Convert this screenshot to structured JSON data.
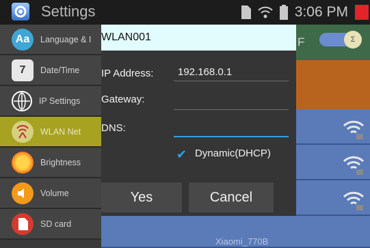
{
  "app": {
    "title": "Settings"
  },
  "status": {
    "time": "3:06 PM"
  },
  "sidebar": {
    "items": [
      {
        "label": "Language & I",
        "icon": "language-icon",
        "selected": false
      },
      {
        "label": "Date/Time",
        "icon": "calendar-icon",
        "selected": false
      },
      {
        "label": "IP Settings",
        "icon": "globe-icon",
        "selected": false
      },
      {
        "label": "WLAN Net",
        "icon": "wlan-icon",
        "selected": true
      },
      {
        "label": "Brightness",
        "icon": "brightness-icon",
        "selected": false
      },
      {
        "label": "Volume",
        "icon": "volume-icon",
        "selected": false
      },
      {
        "label": "SD card",
        "icon": "sd-card-icon",
        "selected": false
      }
    ]
  },
  "content": {
    "header_letter": "F",
    "toggle_knob": "Σ",
    "network_partial": "Xiaomi_770B"
  },
  "dialog": {
    "title": "WLAN001",
    "ip_label": "IP Address:",
    "ip_value": "192.168.0.1",
    "gateway_label": "Gateway:",
    "dns_label": "DNS:",
    "dhcp_label": "Dynamic(DHCP)",
    "dhcp_checked": true,
    "yes_label": "Yes",
    "cancel_label": "Cancel"
  },
  "colors": {
    "accent": "#2ea2e8",
    "selected_sidebar": "#a8a222",
    "wlan_row": "#5a7ab8",
    "close": "#e0242a"
  }
}
